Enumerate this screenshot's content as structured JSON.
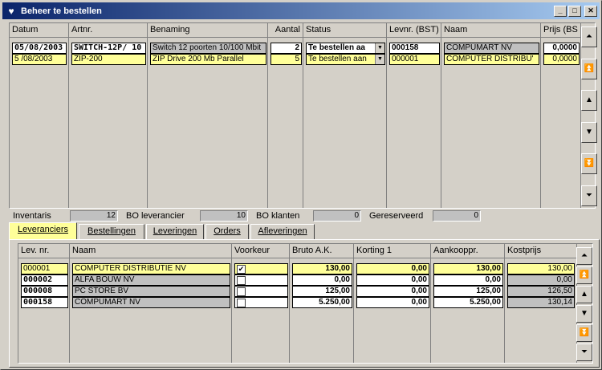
{
  "window": {
    "title": "Beheer te bestellen"
  },
  "orders_table": {
    "headers": [
      "Datum",
      "Artnr.",
      "Benaming",
      "Aantal",
      "Status",
      "Levnr. (BST)",
      "Naam",
      "Prijs (BS"
    ],
    "rows": [
      {
        "datum": "05/08/2003",
        "artnr": "SWITCH-12P/ 10",
        "benaming": "Switch 12 poorten 10/100 Mbit",
        "aantal": "2",
        "status": "Te bestellen aa",
        "levnr": "000158",
        "naam": "COMPUMART NV",
        "prijs": "0,0000"
      },
      {
        "datum": "5 /08/2003",
        "artnr": "ZIP-200",
        "benaming": "ZIP Drive 200 Mb Parallel",
        "aantal": "5",
        "status": "Te bestellen aan",
        "levnr": "000001",
        "naam": "COMPUTER DISTRIBU'",
        "prijs": "0,0000"
      }
    ]
  },
  "summary": {
    "inventaris_label": "Inventaris",
    "inventaris_value": "12",
    "bo_lev_label": "BO leverancier",
    "bo_lev_value": "10",
    "bo_klanten_label": "BO klanten",
    "bo_klanten_value": "0",
    "gereserveerd_label": "Gereserveerd",
    "gereserveerd_value": "0"
  },
  "tabs": [
    "Leveranciers",
    "Bestellingen",
    "Leveringen",
    "Orders",
    "Afleveringen"
  ],
  "suppliers_table": {
    "headers": [
      "Lev. nr.",
      "Naam",
      "Voorkeur",
      "Bruto A.K.",
      "Korting 1",
      "Aankoopp r.",
      "Kostprijs"
    ],
    "header_aankoop": "Aankooppr.",
    "rows": [
      {
        "levnr": "000001",
        "naam": "COMPUTER DISTRIBUTIE NV",
        "voorkeur": "✔",
        "bruto": "130,00",
        "korting": "0,00",
        "aankoop": "130,00",
        "kost": "130,00"
      },
      {
        "levnr": "000002",
        "naam": "ALFA BOUW NV",
        "voorkeur": "",
        "bruto": "0,00",
        "korting": "0,00",
        "aankoop": "0,00",
        "kost": "0,00"
      },
      {
        "levnr": "000008",
        "naam": "PC STORE BV",
        "voorkeur": "",
        "bruto": "125,00",
        "korting": "0,00",
        "aankoop": "125,00",
        "kost": "126,50"
      },
      {
        "levnr": "000158",
        "naam": "COMPUMART NV",
        "voorkeur": "",
        "bruto": "5.250,00",
        "korting": "0,00",
        "aankoop": "5.250,00",
        "kost": "130,14"
      }
    ]
  },
  "icons": {
    "title": "grid-icon",
    "first": "first-record-icon",
    "pageup": "page-up-icon",
    "up": "up-icon",
    "down": "down-icon",
    "pagedown": "page-down-icon",
    "last": "last-record-icon"
  }
}
